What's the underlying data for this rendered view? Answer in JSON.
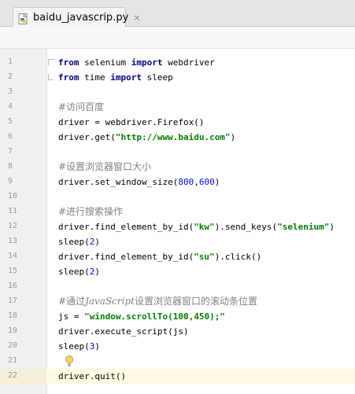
{
  "tab": {
    "label": "baidu_javascrip.py",
    "close": "×",
    "icon": "python-file-icon"
  },
  "editor": {
    "current_line": 22,
    "lines": [
      {
        "n": "1",
        "parts": [
          [
            "kw",
            "from"
          ],
          [
            "t",
            " selenium "
          ],
          [
            "kw",
            "import"
          ],
          [
            "t",
            " webdriver"
          ]
        ]
      },
      {
        "n": "2",
        "parts": [
          [
            "kw",
            "from"
          ],
          [
            "t",
            " time "
          ],
          [
            "kw",
            "import"
          ],
          [
            "t",
            " sleep"
          ]
        ]
      },
      {
        "n": "3",
        "parts": []
      },
      {
        "n": "4",
        "parts": [
          [
            "cm",
            "#访问百度"
          ]
        ]
      },
      {
        "n": "5",
        "parts": [
          [
            "t",
            "driver = webdriver.Firefox()"
          ]
        ]
      },
      {
        "n": "6",
        "parts": [
          [
            "t",
            "driver.get("
          ],
          [
            "str",
            "\"http://www.baidu.com\""
          ],
          [
            "t",
            ")"
          ]
        ]
      },
      {
        "n": "7",
        "parts": []
      },
      {
        "n": "8",
        "parts": [
          [
            "cm",
            "#设置浏览器窗口大小"
          ]
        ]
      },
      {
        "n": "9",
        "parts": [
          [
            "t",
            "driver.set_window_size("
          ],
          [
            "num",
            "800"
          ],
          [
            "t",
            ","
          ],
          [
            "num",
            "600"
          ],
          [
            "t",
            ")"
          ]
        ]
      },
      {
        "n": "10",
        "parts": []
      },
      {
        "n": "11",
        "parts": [
          [
            "cm",
            "#进行搜索操作"
          ]
        ]
      },
      {
        "n": "12",
        "parts": [
          [
            "t",
            "driver.find_element_by_id("
          ],
          [
            "str",
            "\"kw\""
          ],
          [
            "t",
            ").send_keys("
          ],
          [
            "str",
            "\"selenium\""
          ],
          [
            "t",
            ")"
          ]
        ]
      },
      {
        "n": "13",
        "parts": [
          [
            "t",
            "sleep("
          ],
          [
            "num",
            "2"
          ],
          [
            "t",
            ")"
          ]
        ]
      },
      {
        "n": "14",
        "parts": [
          [
            "t",
            "driver.find_element_by_id("
          ],
          [
            "str",
            "\"su\""
          ],
          [
            "t",
            ").click()"
          ]
        ]
      },
      {
        "n": "15",
        "parts": [
          [
            "t",
            "sleep("
          ],
          [
            "num",
            "2"
          ],
          [
            "t",
            ")"
          ]
        ]
      },
      {
        "n": "16",
        "parts": []
      },
      {
        "n": "17",
        "parts": [
          [
            "cm",
            "#通过"
          ],
          [
            "cm-it",
            "JavaScript"
          ],
          [
            "cm",
            "设置浏览器窗口的滚动条位置"
          ]
        ]
      },
      {
        "n": "18",
        "parts": [
          [
            "t",
            "js = "
          ],
          [
            "str",
            "\"window.scrollTo(100,450);\""
          ]
        ]
      },
      {
        "n": "19",
        "parts": [
          [
            "t",
            "driver.execute_script(js)"
          ]
        ]
      },
      {
        "n": "20",
        "parts": [
          [
            "t",
            "sleep("
          ],
          [
            "num",
            "3"
          ],
          [
            "t",
            ")"
          ]
        ]
      },
      {
        "n": "21",
        "parts": []
      },
      {
        "n": "22",
        "parts": [
          [
            "t",
            "driver.quit()"
          ]
        ]
      }
    ],
    "bulb_line": 21,
    "fold_start_line": 1,
    "fold_end_line": 2
  }
}
